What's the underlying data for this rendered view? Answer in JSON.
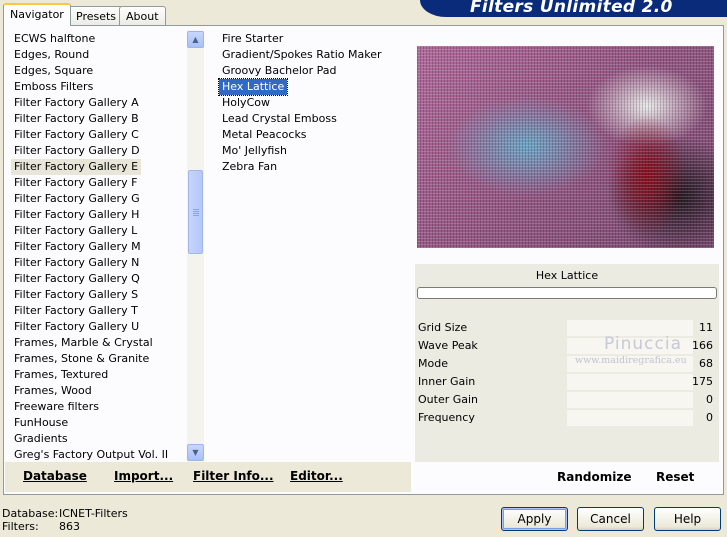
{
  "tabs": [
    "Navigator",
    "Presets",
    "About"
  ],
  "banner_title": "Filters Unlimited 2.0",
  "categories": {
    "selected_index": 8,
    "items": [
      "ECWS halftone",
      "Edges, Round",
      "Edges, Square",
      "Emboss Filters",
      "Filter Factory Gallery A",
      "Filter Factory Gallery B",
      "Filter Factory Gallery C",
      "Filter Factory Gallery D",
      "Filter Factory Gallery E",
      "Filter Factory Gallery F",
      "Filter Factory Gallery G",
      "Filter Factory Gallery H",
      "Filter Factory Gallery L",
      "Filter Factory Gallery M",
      "Filter Factory Gallery N",
      "Filter Factory Gallery Q",
      "Filter Factory Gallery S",
      "Filter Factory Gallery T",
      "Filter Factory Gallery U",
      "Frames, Marble & Crystal",
      "Frames, Stone & Granite",
      "Frames, Textured",
      "Frames, Wood",
      "Freeware filters",
      "FunHouse",
      "Gradients",
      "Greg's Factory Output Vol. II"
    ]
  },
  "filters": {
    "selected_index": 3,
    "items": [
      "Fire Starter",
      "Gradient/Spokes Ratio Maker",
      "Groovy Bachelor Pad",
      "Hex Lattice",
      "HolyCow",
      "Lead Crystal Emboss",
      "Metal Peacocks",
      "Mo' Jellyfish",
      "Zebra Fan"
    ]
  },
  "toolbar": {
    "database": "Database",
    "import": "Import...",
    "filter_info": "Filter Info...",
    "editor": "Editor..."
  },
  "preview": {
    "filter_name": "Hex Lattice"
  },
  "params": [
    {
      "label": "Grid Size",
      "value": "11"
    },
    {
      "label": "Wave Peak",
      "value": "166"
    },
    {
      "label": "Mode",
      "value": "68"
    },
    {
      "label": "Inner Gain",
      "value": "175"
    },
    {
      "label": "Outer Gain",
      "value": "0"
    },
    {
      "label": "Frequency",
      "value": "0"
    }
  ],
  "watermark": {
    "name": "Pinuccia",
    "url": "www.maidiregrafica.eu"
  },
  "right_buttons": {
    "randomize": "Randomize",
    "reset": "Reset"
  },
  "footer": {
    "database_label": "Database:",
    "database_value": "ICNET-Filters",
    "filters_label": "Filters:",
    "filters_value": "863"
  },
  "dialog_buttons": {
    "apply": "Apply",
    "cancel": "Cancel",
    "help": "Help"
  }
}
